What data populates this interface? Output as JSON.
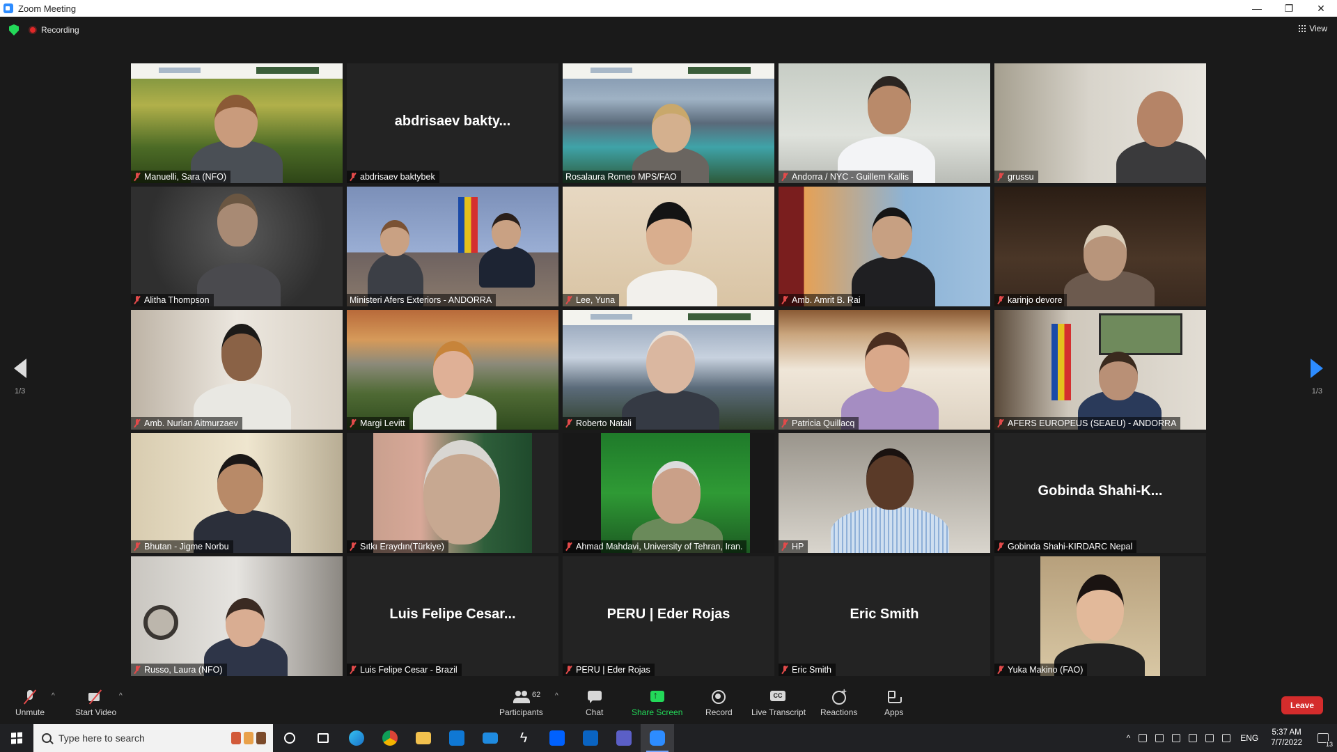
{
  "window": {
    "title": "Zoom Meeting",
    "controls": [
      "—",
      "❐",
      "✕"
    ]
  },
  "topbar": {
    "recording_label": "Recording",
    "view_label": "View"
  },
  "pagination": {
    "left": "1/3",
    "right": "1/3"
  },
  "participants": [
    {
      "name": "Manuelli, Sara (NFO)",
      "video": true,
      "active": false
    },
    {
      "name": "abdrisaev baktybek",
      "video": false,
      "display": "abdrisaev bakty...",
      "active": false
    },
    {
      "name": "Rosalaura Romeo MPS/FAO",
      "video": true,
      "active": true
    },
    {
      "name": "Andorra / NYC - Guillem Kallis",
      "video": true,
      "active": false
    },
    {
      "name": "grussu",
      "video": true,
      "active": false
    },
    {
      "name": "Alitha Thompson",
      "video": true,
      "active": false
    },
    {
      "name": "Ministeri Afers Exteriors - ANDORRA",
      "video": true,
      "active": false
    },
    {
      "name": "Lee, Yuna",
      "video": true,
      "active": false
    },
    {
      "name": "Amb. Amrit B. Rai",
      "video": true,
      "active": false
    },
    {
      "name": "karinjo devore",
      "video": true,
      "active": false
    },
    {
      "name": "Amb. Nurlan Aitmurzaev",
      "video": true,
      "active": false
    },
    {
      "name": "Margi Levitt",
      "video": true,
      "active": false
    },
    {
      "name": "Roberto Natali",
      "video": true,
      "active": false
    },
    {
      "name": "Patricia Quillacq",
      "video": true,
      "active": false
    },
    {
      "name": "AFERS EUROPEUS (SEAEU) - ANDORRA",
      "video": true,
      "active": false
    },
    {
      "name": "Bhutan - Jigme Norbu",
      "video": true,
      "active": false
    },
    {
      "name": "Sıtkı Eraydın(Türkiye)",
      "video": true,
      "active": false
    },
    {
      "name": "Ahmad Mahdavi, University of Tehran, Iran.",
      "video": true,
      "active": false
    },
    {
      "name": "HP",
      "video": true,
      "active": false
    },
    {
      "name": "Gobinda Shahi-KIRDARC Nepal",
      "video": false,
      "display": "Gobinda Shahi-K...",
      "active": false
    },
    {
      "name": "Russo, Laura (NFO)",
      "video": true,
      "active": false
    },
    {
      "name": "Luis Felipe Cesar - Brazil",
      "video": false,
      "display": "Luis Felipe Cesar...",
      "active": false
    },
    {
      "name": "PERU | Eder Rojas",
      "video": false,
      "display": "PERU | Eder Rojas",
      "active": false
    },
    {
      "name": "Eric Smith",
      "video": false,
      "display": "Eric Smith",
      "active": false
    },
    {
      "name": "Yuka Makino (FAO)",
      "video": true,
      "active": false
    }
  ],
  "toolbar": {
    "unmute": "Unmute",
    "start_video": "Start Video",
    "participants": "Participants",
    "participants_count": "62",
    "chat": "Chat",
    "share_screen": "Share Screen",
    "record": "Record",
    "live_transcript": "Live Transcript",
    "reactions": "Reactions",
    "apps": "Apps",
    "leave": "Leave"
  },
  "taskbar": {
    "search_placeholder": "Type here to search",
    "language": "ENG",
    "time": "5:37 AM",
    "date": "7/7/2022",
    "notification_count": "13"
  },
  "colors": {
    "active_speaker": "#c8e43f",
    "share": "#23d959",
    "leave": "#d42c2c",
    "accent": "#2d8cff"
  }
}
